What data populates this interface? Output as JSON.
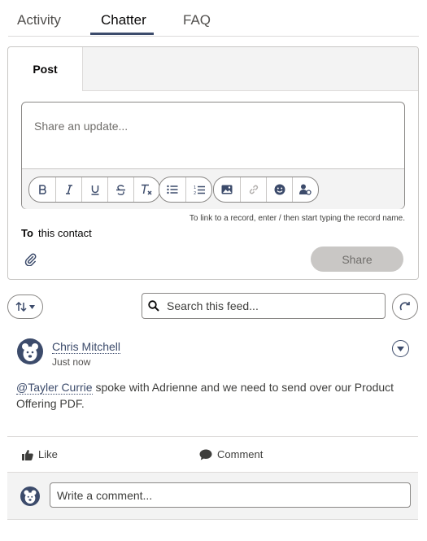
{
  "tabs": [
    {
      "label": "Activity"
    },
    {
      "label": "Chatter"
    },
    {
      "label": "FAQ"
    }
  ],
  "active_tab": "Chatter",
  "composer": {
    "tab_label": "Post",
    "placeholder": "Share an update...",
    "toolbar": {
      "format": [
        "bold-icon",
        "italic-icon",
        "underline-icon",
        "strikethrough-icon",
        "clear-format-icon"
      ],
      "lists": [
        "bulleted-list-icon",
        "numbered-list-icon"
      ],
      "insert": [
        "image-icon",
        "link-icon",
        "emoji-icon",
        "mention-icon"
      ]
    },
    "hint": "To link to a record, enter / then start typing the record name.",
    "to_label": "To",
    "to_value": "this contact",
    "share_label": "Share"
  },
  "feed": {
    "search_placeholder": "Search this feed...",
    "post": {
      "author": "Chris Mitchell",
      "time": "Just now",
      "mention": "@Tayler Currie",
      "body": " spoke with Adrienne and we need to send over our Product Offering PDF."
    },
    "like_label": "Like",
    "comment_label": "Comment",
    "comment_placeholder": "Write a comment..."
  },
  "colors": {
    "accent": "#3c4b6b",
    "border": "#dddbda",
    "panel": "#f3f3f3",
    "disabled_button": "#c9c7c5"
  }
}
